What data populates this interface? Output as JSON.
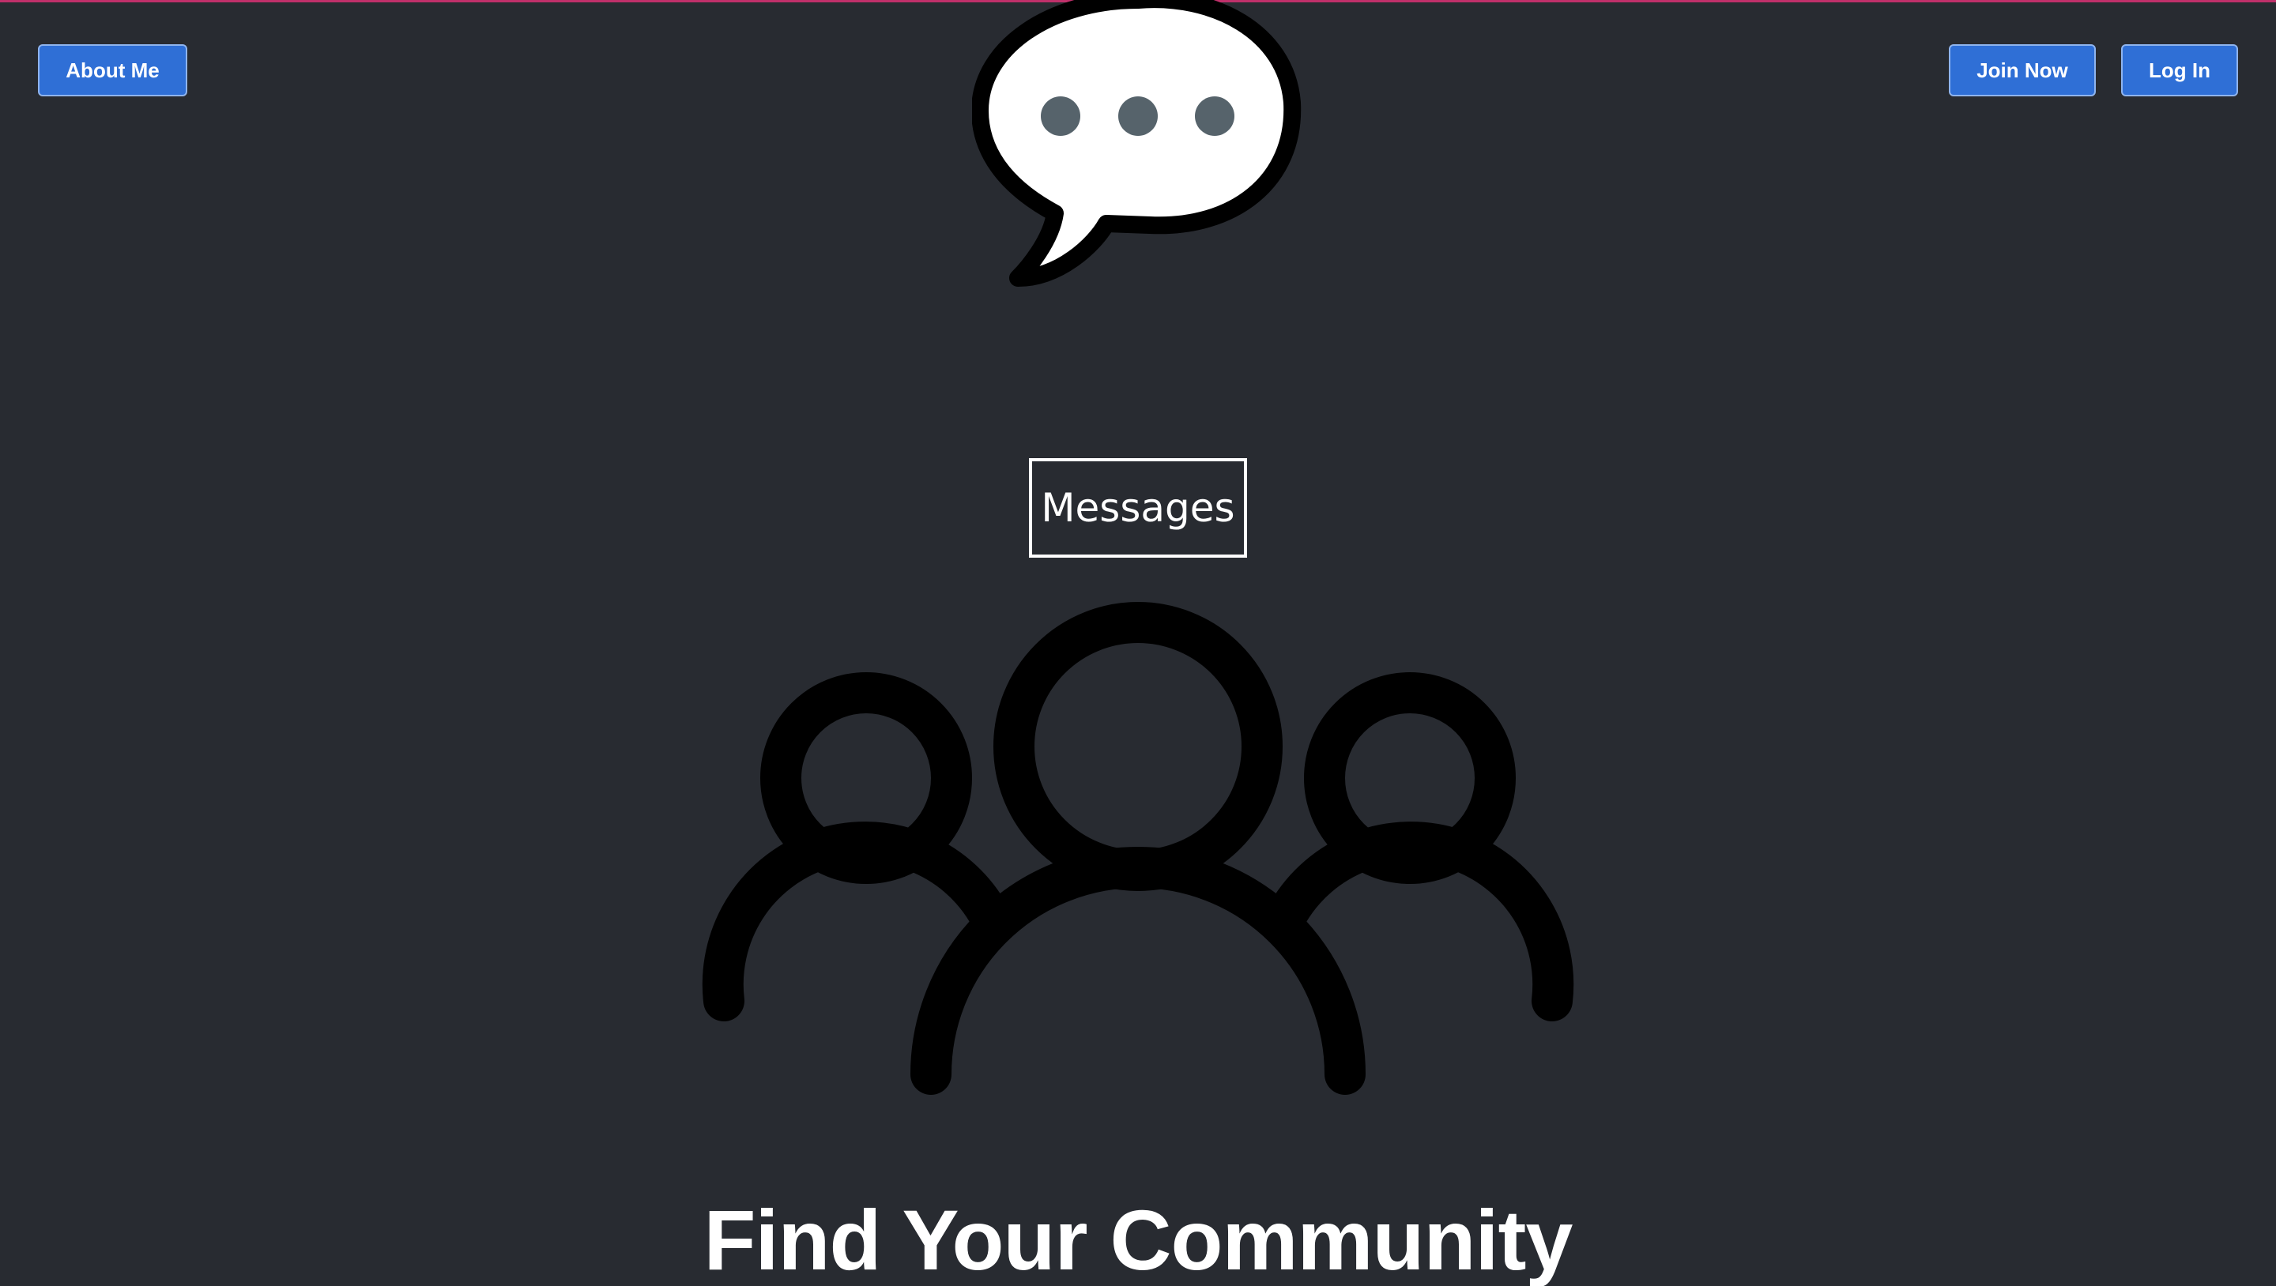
{
  "header": {
    "about_label": "About Me",
    "join_label": "Join Now",
    "login_label": "Log In"
  },
  "main": {
    "messages_label": "Messages",
    "hero_title": "Find Your Community"
  },
  "icons": {
    "logo": "speech-bubble-icon",
    "community": "group-of-people-icon"
  },
  "colors": {
    "background": "#282b31",
    "accent_bar": "#c0306a",
    "button": "#2f6fd6",
    "text": "#ffffff",
    "bubble_dots": "#56636b"
  }
}
